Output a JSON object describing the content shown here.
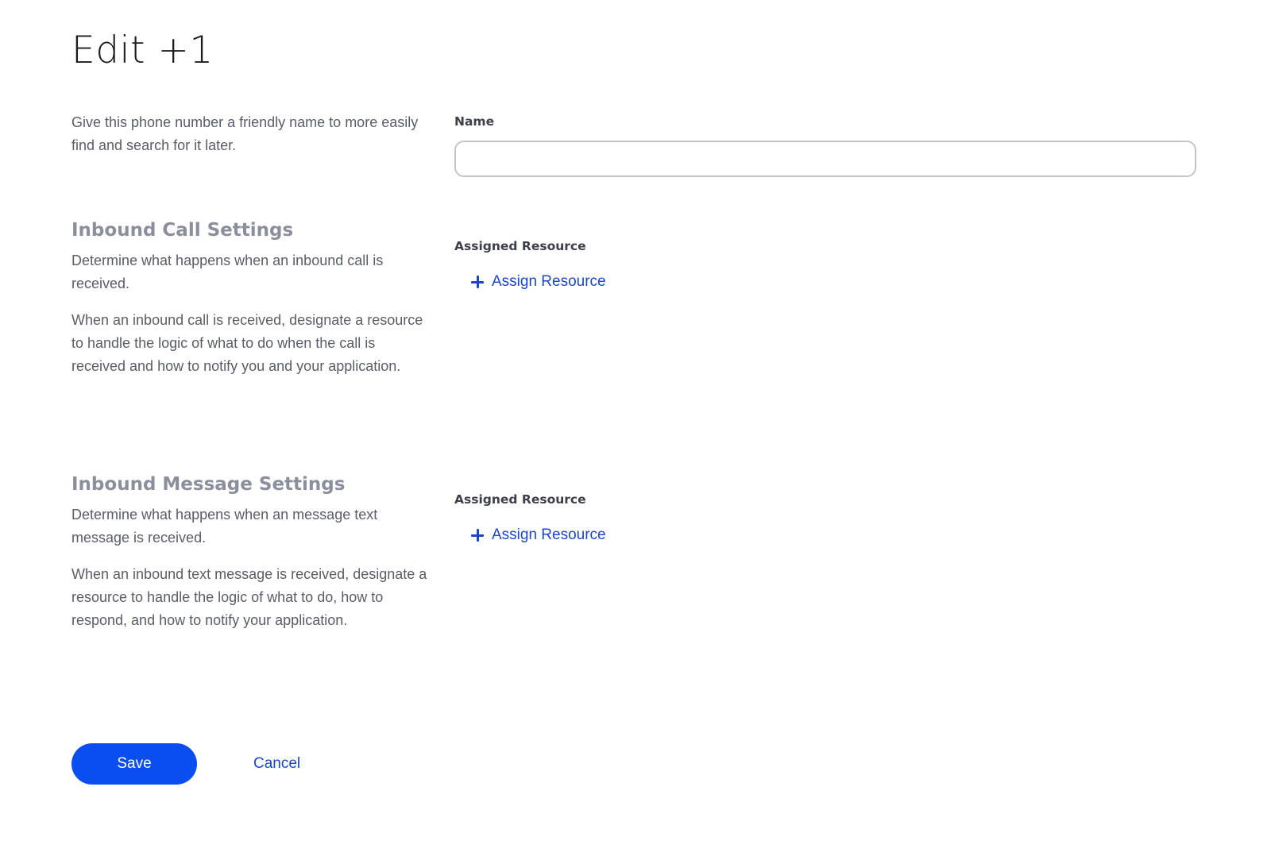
{
  "page": {
    "title": "Edit +1"
  },
  "name_section": {
    "description": "Give this phone number a friendly name to more easily find and search for it later.",
    "label": "Name",
    "value": "",
    "placeholder": ""
  },
  "call_section": {
    "heading": "Inbound Call Settings",
    "description_1": "Determine what happens when an inbound call is received.",
    "description_2": "When an inbound call is received, designate a resource to handle the logic of what to do when the call is received and how to notify you and your application.",
    "resource_label": "Assigned Resource",
    "assign_label": "Assign Resource",
    "assign_icon": "plus-icon"
  },
  "message_section": {
    "heading": "Inbound Message Settings",
    "description_1": "Determine what happens when an message text message is received.",
    "description_2": "When an inbound text message is received, designate a resource to handle the logic of what to do, how to respond, and how to notify your application.",
    "resource_label": "Assigned Resource",
    "assign_label": "Assign Resource",
    "assign_icon": "plus-icon"
  },
  "actions": {
    "save_label": "Save",
    "cancel_label": "Cancel"
  },
  "colors": {
    "primary": "#0b4ef0",
    "link": "#1a47c6",
    "heading_muted": "#8a8f9b"
  }
}
